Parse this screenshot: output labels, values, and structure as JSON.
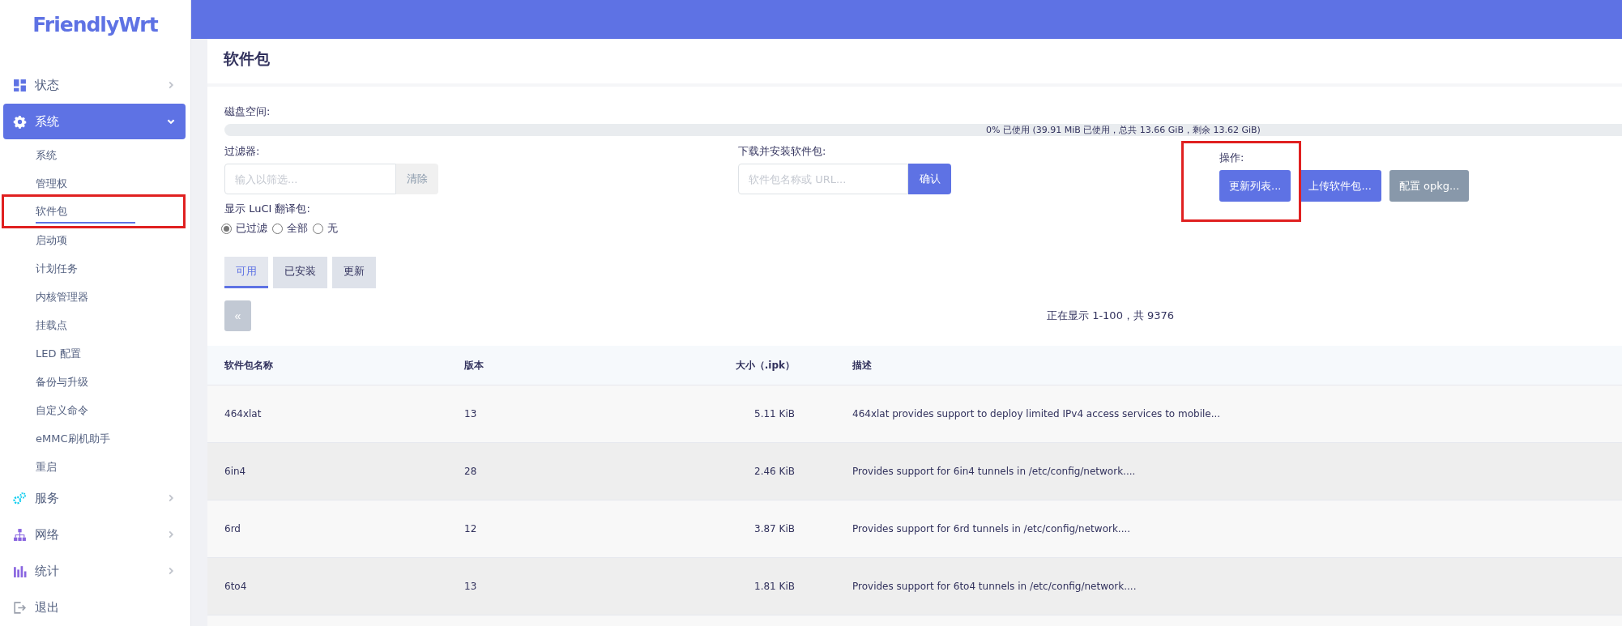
{
  "brand": "FriendlyWrt",
  "sidebar": {
    "items": [
      {
        "label": "状态",
        "kind": "dashboard",
        "expanded": false,
        "selected": false
      },
      {
        "label": "系统",
        "kind": "gear",
        "expanded": true,
        "selected": true,
        "children": [
          {
            "label": "系统",
            "selected": false,
            "highlighted": false
          },
          {
            "label": "管理权",
            "selected": false,
            "highlighted": false
          },
          {
            "label": "软件包",
            "selected": true,
            "highlighted": true
          },
          {
            "label": "启动项",
            "selected": false,
            "highlighted": false
          },
          {
            "label": "计划任务",
            "selected": false,
            "highlighted": false
          },
          {
            "label": "内核管理器",
            "selected": false,
            "highlighted": false
          },
          {
            "label": "挂载点",
            "selected": false,
            "highlighted": false
          },
          {
            "label": "LED 配置",
            "selected": false,
            "highlighted": false
          },
          {
            "label": "备份与升级",
            "selected": false,
            "highlighted": false
          },
          {
            "label": "自定义命令",
            "selected": false,
            "highlighted": false
          },
          {
            "label": "eMMC刷机助手",
            "selected": false,
            "highlighted": false
          },
          {
            "label": "重启",
            "selected": false,
            "highlighted": false
          }
        ]
      },
      {
        "label": "服务",
        "kind": "gears",
        "expanded": false,
        "selected": false
      },
      {
        "label": "网络",
        "kind": "network",
        "expanded": false,
        "selected": false
      },
      {
        "label": "统计",
        "kind": "chart",
        "expanded": false,
        "selected": false
      },
      {
        "label": "退出",
        "kind": "logout",
        "selected": false
      }
    ]
  },
  "page": {
    "title": "软件包",
    "disk": {
      "label": "磁盘空间:",
      "level": 0,
      "reading": "0% 已使用 (39.91 MiB 已使用，总共 13.66 GiB，剩余 13.62 GiB)"
    },
    "filter": {
      "label": "过滤器:",
      "placeholder": "输入以筛选...",
      "button": "清除"
    },
    "download": {
      "label": "下载并安装软件包:",
      "placeholder": "软件包名称或 URL...",
      "button": "确认"
    },
    "actions": {
      "label": "操作:",
      "highlighted": true,
      "buttons": [
        {
          "label": "更新列表...",
          "kind": "primary"
        },
        {
          "label": "上传软件包...",
          "kind": "primary"
        },
        {
          "label": "配置 opkg...",
          "kind": "secondary"
        }
      ]
    },
    "translations": {
      "label": "显示 LuCI 翻译包:",
      "options": [
        {
          "label": "已过滤",
          "selected": true
        },
        {
          "label": "全部",
          "selected": false
        },
        {
          "label": "无",
          "selected": false
        }
      ]
    },
    "tabs": [
      {
        "label": "可用",
        "selected": true
      },
      {
        "label": "已安装",
        "selected": false
      },
      {
        "label": "更新",
        "selected": false
      }
    ],
    "pager": {
      "prev": "«",
      "status": "正在显示 1-100，共 9376"
    },
    "table": {
      "columns": [
        "软件包名称",
        "版本",
        "大小（.ipk）",
        "描述"
      ],
      "rows": [
        [
          "464xlat",
          "13",
          "5.11 KiB",
          "464xlat provides support to deploy limited IPv4 access services to mobile..."
        ],
        [
          "6in4",
          "28",
          "2.46 KiB",
          "Provides support for 6in4 tunnels in /etc/config/network...."
        ],
        [
          "6rd",
          "12",
          "3.87 KiB",
          "Provides support for 6rd tunnels in /etc/config/network...."
        ],
        [
          "6to4",
          "13",
          "1.81 KiB",
          "Provides support for 6to4 tunnels in /etc/config/network...."
        ]
      ]
    }
  }
}
